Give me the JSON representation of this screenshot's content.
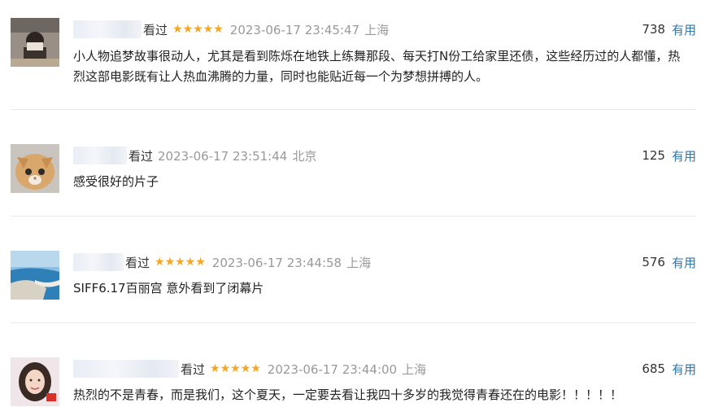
{
  "reviews": [
    {
      "watched_label": "看过",
      "stars": "★★★★★",
      "date": "2023-06-17 23:45:47",
      "location": "上海",
      "votes": "738",
      "vote_label": "有用",
      "content": "小人物追梦故事很动人，尤其是看到陈烁在地铁上练舞那段、每天打N份工给家里还债，这些经历过的人都懂，热烈这部电影既有让人热血沸腾的力量，同时也能贴近每一个为梦想拼搏的人。"
    },
    {
      "watched_label": "看过",
      "stars": "",
      "date": "2023-06-17 23:51:44",
      "location": "北京",
      "votes": "125",
      "vote_label": "有用",
      "content": "感受很好的片子"
    },
    {
      "watched_label": "看过",
      "stars": "★★★★★",
      "date": "2023-06-17 23:44:58",
      "location": "上海",
      "votes": "576",
      "vote_label": "有用",
      "content": "SIFF6.17百丽宫 意外看到了闭幕片"
    },
    {
      "watched_label": "看过",
      "stars": "★★★★★",
      "date": "2023-06-17 23:44:00",
      "location": "上海",
      "votes": "685",
      "vote_label": "有用",
      "content": "热烈的不是青春，而是我们，这个夏天，一定要去看让我四十多岁的我觉得青春还在的电影！！！！！"
    }
  ],
  "colors": {
    "star": "#f5a623",
    "link": "#3377aa",
    "meta": "#999999"
  }
}
